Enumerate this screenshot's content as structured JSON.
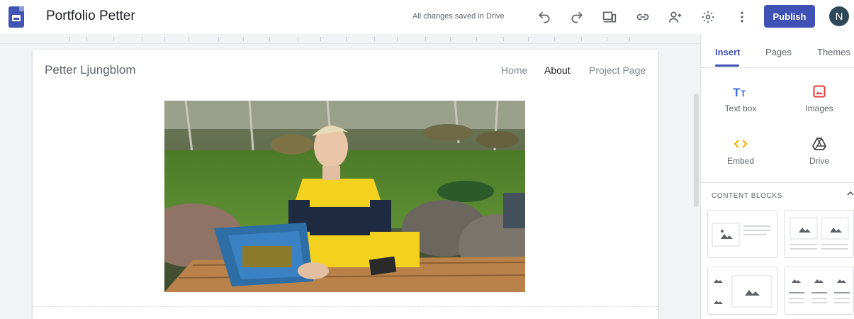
{
  "topbar": {
    "site_title": "Portfolio Petter",
    "save_status": "All changes saved in Drive",
    "icons": [
      "undo-icon",
      "redo-icon",
      "preview-icon",
      "link-icon",
      "share-icon",
      "settings-icon",
      "more-icon"
    ],
    "publish_label": "Publish",
    "avatar_initial": "N",
    "accent_color": "#3f51b5"
  },
  "page": {
    "owner_name": "Petter Ljungblom",
    "nav": {
      "home": "Home",
      "about": "About",
      "project": "Project Page"
    },
    "hero_image": "photo of young man with laptop at outdoor wooden table"
  },
  "panel": {
    "tabs": {
      "insert": "Insert",
      "pages": "Pages",
      "themes": "Themes"
    },
    "insert_items": {
      "text_box": "Text box",
      "images": "Images",
      "embed": "Embed",
      "drive": "Drive"
    },
    "content_blocks_title": "CONTENT BLOCKS"
  }
}
